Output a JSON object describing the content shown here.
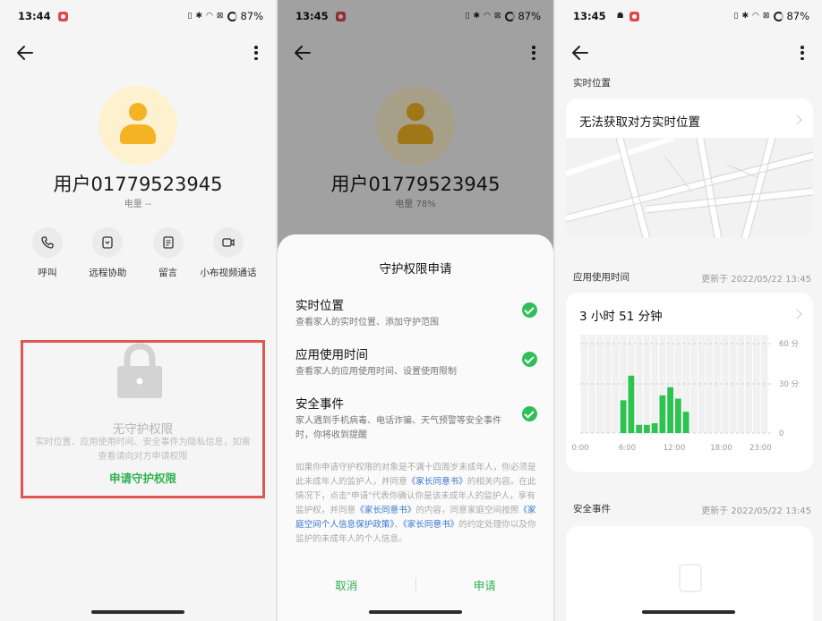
{
  "colors": {
    "accent_green": "#2db34e",
    "chart_green": "#2cc44f",
    "avatar_yellow": "#f3b323",
    "highlight_red": "#e15552",
    "link_blue": "#3a76d2"
  },
  "screen1": {
    "status": {
      "time": "13:44",
      "battery": "87%"
    },
    "user": {
      "name": "用户01779523945",
      "battery_line": "电量 --"
    },
    "actions": [
      {
        "label": "呼叫",
        "icon": "phone-icon"
      },
      {
        "label": "远程协助",
        "icon": "remote-assist-icon"
      },
      {
        "label": "留言",
        "icon": "message-icon"
      },
      {
        "label": "小布视频通话",
        "icon": "video-call-icon"
      }
    ],
    "no_permission": {
      "title": "无守护权限",
      "desc": "实时位置、应用使用时间、安全事件为隐私信息，如需查看请向对方申请权限",
      "link": "申请守护权限"
    }
  },
  "screen2": {
    "status": {
      "time": "13:45",
      "battery": "87%"
    },
    "user": {
      "name": "用户01779523945",
      "battery_line": "电量 78%"
    },
    "sheet": {
      "title": "守护权限申请",
      "permissions": [
        {
          "title": "实时位置",
          "desc": "查看家人的实时位置、添加守护范围"
        },
        {
          "title": "应用使用时间",
          "desc": "查看家人的应用使用时间、设置使用限制"
        },
        {
          "title": "安全事件",
          "desc": "家人遇到手机病毒、电话诈骗、天气预警等安全事件时，你将收到提醒"
        }
      ],
      "notice": {
        "p1": "如果你申请守护权限的对象是不满十四周岁未成年人，你必须是此未成年人的监护人，并同意",
        "l1": "《家长同意书》",
        "p2": "的相关内容。在此情况下，点击\"申请\"代表你确认你是该未成年人的监护人，享有监护权，并同意",
        "l2": "《家长同意书》",
        "p3": "的内容，同意家庭空间按照",
        "l3": "《家庭空间个人信息保护政策》",
        "p4": "、",
        "l4": "《家长同意书》",
        "p5": "的约定处理你以及你监护的未成年人的个人信息。"
      },
      "cancel": "取消",
      "apply": "申请"
    }
  },
  "screen3": {
    "status": {
      "time": "13:45",
      "battery": "87%"
    },
    "location": {
      "section": "实时位置",
      "message": "无法获取对方实时位置"
    },
    "usage": {
      "section": "应用使用时间",
      "updated": "更新于 2022/05/22 13:45",
      "total": "3 小时 51 分钟"
    },
    "safety": {
      "section": "安全事件",
      "updated": "更新于 2022/05/22 13:45"
    }
  },
  "chart_data": {
    "type": "bar",
    "title": "",
    "xlabel": "",
    "ylabel": "",
    "x_ticks": [
      "0:00",
      "6:00",
      "12:00",
      "18:00",
      "23:00"
    ],
    "y_ticks": [
      "60 分",
      "30 分",
      "0"
    ],
    "ylim": [
      0,
      60
    ],
    "grid": true,
    "categories": [
      "0:00",
      "1:00",
      "2:00",
      "3:00",
      "4:00",
      "5:00",
      "6:00",
      "7:00",
      "8:00",
      "9:00",
      "10:00",
      "11:00",
      "12:00",
      "13:00",
      "14:00",
      "15:00",
      "16:00",
      "17:00",
      "18:00",
      "19:00",
      "20:00",
      "21:00",
      "22:00",
      "23:00"
    ],
    "values": [
      0,
      0,
      0,
      0,
      0,
      20,
      35,
      5,
      5,
      6,
      23,
      28,
      21,
      13,
      0,
      0,
      0,
      0,
      0,
      0,
      0,
      0,
      0,
      0
    ]
  }
}
